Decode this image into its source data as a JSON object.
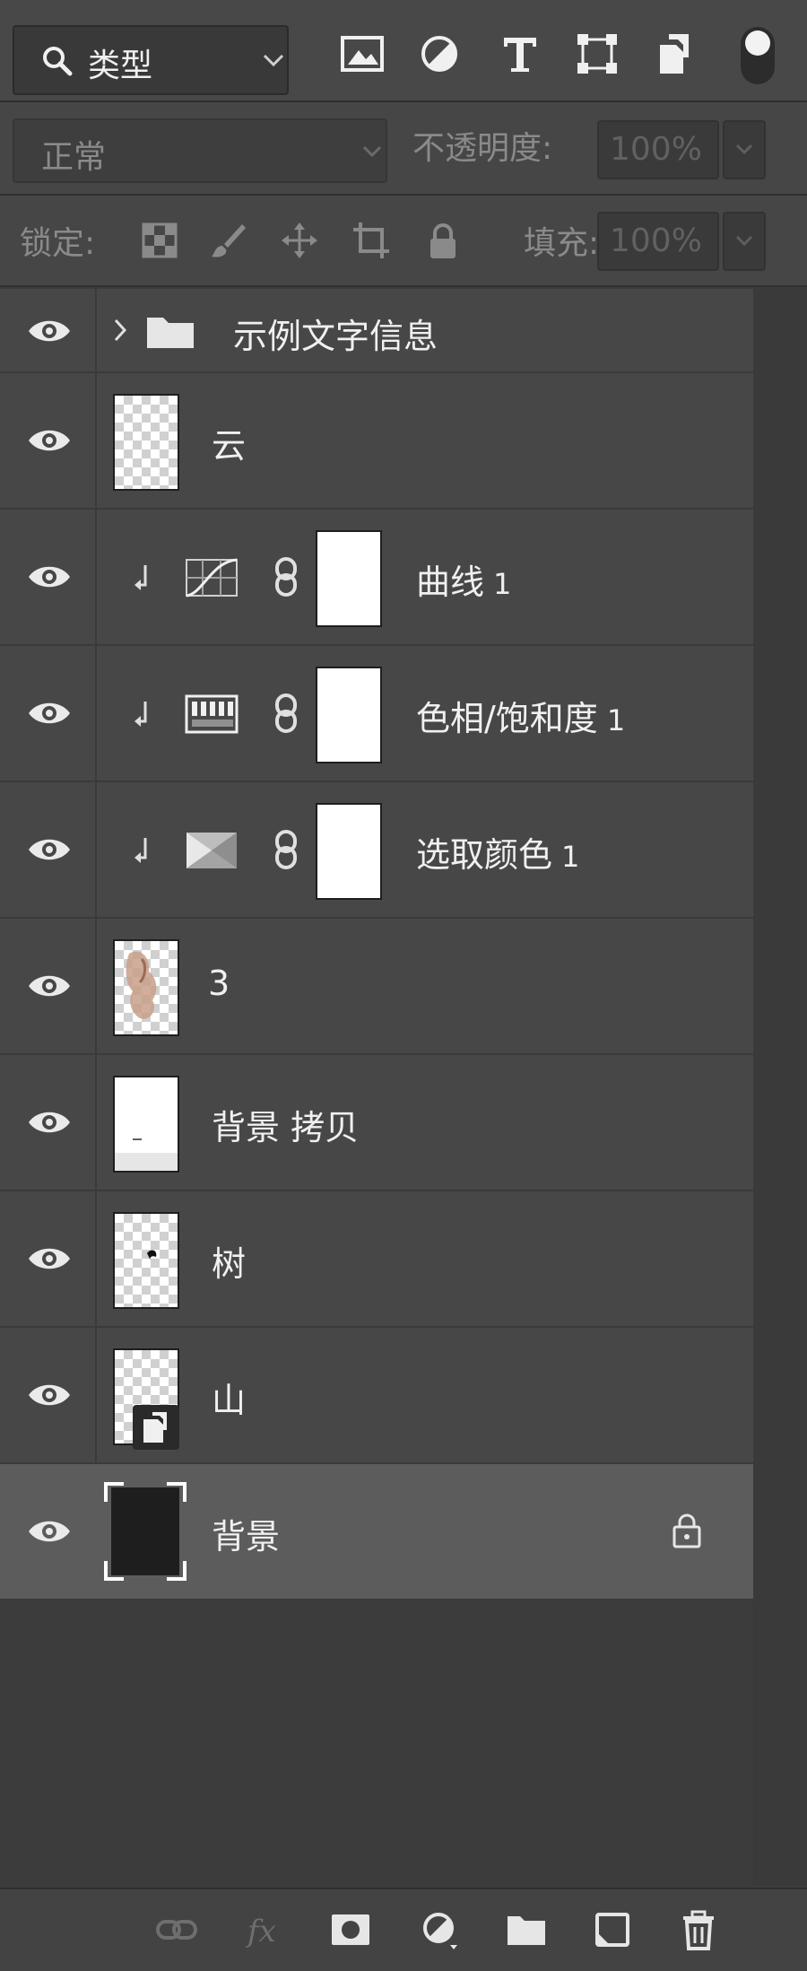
{
  "filter": {
    "label": "类型"
  },
  "blend": {
    "mode": "正常",
    "opacity_label": "不透明度:",
    "opacity_value": "100%"
  },
  "lock": {
    "label": "锁定:",
    "fill_label": "填充:",
    "fill_value": "100%"
  },
  "layers": {
    "group": {
      "name": "示例文字信息"
    },
    "cloud": {
      "name": "云"
    },
    "curves": {
      "name": "曲线",
      "num": "1"
    },
    "hue": {
      "name": "色相/饱和度",
      "num": "1"
    },
    "selcolor": {
      "name": "选取颜色",
      "num": "1"
    },
    "three": {
      "name": "3"
    },
    "bgcopy": {
      "name": "背景 拷贝"
    },
    "tree": {
      "name": "树"
    },
    "mountain": {
      "name": "山"
    },
    "background": {
      "name": "背景"
    }
  },
  "icons": {
    "filter_row": [
      "search-icon",
      "chevron-down-icon",
      "image-filter-icon",
      "adjustment-filter-icon",
      "type-filter-icon",
      "shape-filter-icon",
      "smart-object-filter-icon",
      "filter-toggle"
    ],
    "lock_row": [
      "lock-transparent-icon",
      "lock-paint-icon",
      "lock-move-icon",
      "lock-artboard-icon",
      "lock-all-icon"
    ],
    "bottom_bar": [
      "link-layers-icon",
      "fx-icon",
      "add-mask-icon",
      "new-adjustment-icon",
      "new-group-icon",
      "new-layer-icon",
      "delete-icon"
    ]
  },
  "colors": {
    "panel": "#474747",
    "selected_row": "#5c5c5c",
    "text": "#f0f0f0",
    "muted": "#8a8a8a"
  }
}
